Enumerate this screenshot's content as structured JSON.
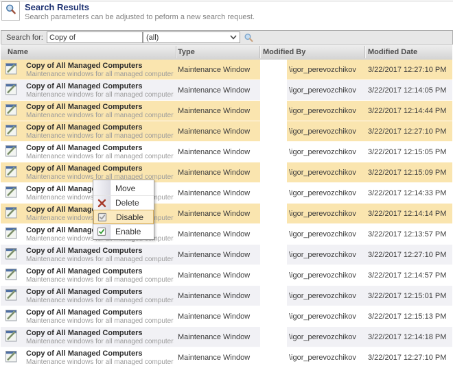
{
  "page": {
    "title": "Search Results",
    "subtitle": "Search parameters can be adjusted to peform a new search request."
  },
  "search_bar": {
    "label": "Search for:",
    "query_value": "Copy of",
    "filter_value": "(all)"
  },
  "icons": {
    "page_icon": "magnifier",
    "search_button": "magnifier",
    "row_icon": "maintenance-window",
    "dropdown": "chevron-down"
  },
  "colors": {
    "title_blue": "#1e3272",
    "selected_row": "#fae5af",
    "alt_row": "#f1f1f5",
    "menu_highlight_bg": "#fbeac0",
    "menu_highlight_border": "#d8af5e",
    "delete_x": "#a63a2a",
    "enable_check": "#2e9b2e"
  },
  "table": {
    "columns": [
      "Name",
      "Type",
      "Modified By",
      "Modified Date"
    ],
    "rows": [
      {
        "name": "Copy of All Managed Computers",
        "desc": "Maintenance windows for all managed computers.",
        "type": "Maintenance Window",
        "modified_by": "\\igor_perevozchikov",
        "modified_date": "3/22/2017 12:27:10 PM",
        "state": "selected"
      },
      {
        "name": "Copy of All Managed Computers",
        "desc": "Maintenance windows for all managed computers.",
        "type": "Maintenance Window",
        "modified_by": "\\igor_perevozchikov",
        "modified_date": "3/22/2017 12:14:05 PM",
        "state": "alt"
      },
      {
        "name": "Copy of All Managed Computers",
        "desc": "Maintenance windows for all managed computers.",
        "type": "Maintenance Window",
        "modified_by": "\\igor_perevozchikov",
        "modified_date": "3/22/2017 12:14:44 PM",
        "state": "selected"
      },
      {
        "name": "Copy of All Managed Computers",
        "desc": "Maintenance windows for all managed computers.",
        "type": "Maintenance Window",
        "modified_by": "\\igor_perevozchikov",
        "modified_date": "3/22/2017 12:27:10 PM",
        "state": "selected"
      },
      {
        "name": "Copy of All Managed Computers",
        "desc": "Maintenance windows for all managed computers.",
        "type": "Maintenance Window",
        "modified_by": "\\igor_perevozchikov",
        "modified_date": "3/22/2017 12:15:05 PM",
        "state": "plain"
      },
      {
        "name": "Copy of All Managed Computers",
        "desc": "Maintenance windows for all managed computers.",
        "type": "Maintenance Window",
        "modified_by": "\\igor_perevozchikov",
        "modified_date": "3/22/2017 12:15:09 PM",
        "state": "selected"
      },
      {
        "name": "Copy of All Managed Computers",
        "desc": "Maintenance windows for all managed computers.",
        "type": "Maintenance Window",
        "modified_by": "\\igor_perevozchikov",
        "modified_date": "3/22/2017 12:14:33 PM",
        "state": "plain"
      },
      {
        "name": "Copy of All Managed Computers",
        "desc": "Maintenance windows for all managed computers.",
        "type": "Maintenance Window",
        "modified_by": "\\igor_perevozchikov",
        "modified_date": "3/22/2017 12:14:14 PM",
        "state": "selected"
      },
      {
        "name": "Copy of All Managed Computers",
        "desc": "Maintenance windows for all managed computers.",
        "type": "Maintenance Window",
        "modified_by": "\\igor_perevozchikov",
        "modified_date": "3/22/2017 12:13:57 PM",
        "state": "plain"
      },
      {
        "name": "Copy of All Managed Computers",
        "desc": "Maintenance windows for all managed computers.",
        "type": "Maintenance Window",
        "modified_by": "\\igor_perevozchikov",
        "modified_date": "3/22/2017 12:27:10 PM",
        "state": "alt"
      },
      {
        "name": "Copy of All Managed Computers",
        "desc": "Maintenance windows for all managed computers.",
        "type": "Maintenance Window",
        "modified_by": "\\igor_perevozchikov",
        "modified_date": "3/22/2017 12:14:57 PM",
        "state": "plain"
      },
      {
        "name": "Copy of All Managed Computers",
        "desc": "Maintenance windows for all managed computers.",
        "type": "Maintenance Window",
        "modified_by": "\\igor_perevozchikov",
        "modified_date": "3/22/2017 12:15:01 PM",
        "state": "alt"
      },
      {
        "name": "Copy of All Managed Computers",
        "desc": "Maintenance windows for all managed computers.",
        "type": "Maintenance Window",
        "modified_by": "\\igor_perevozchikov",
        "modified_date": "3/22/2017 12:15:13 PM",
        "state": "plain"
      },
      {
        "name": "Copy of All Managed Computers",
        "desc": "Maintenance windows for all managed computers.",
        "type": "Maintenance Window",
        "modified_by": "\\igor_perevozchikov",
        "modified_date": "3/22/2017 12:14:18 PM",
        "state": "alt"
      },
      {
        "name": "Copy of All Managed Computers",
        "desc": "Maintenance windows for all managed computers.",
        "type": "Maintenance Window",
        "modified_by": "\\igor_perevozchikov",
        "modified_date": "3/22/2017 12:27:10 PM",
        "state": "plain"
      }
    ]
  },
  "context_menu": {
    "items": [
      {
        "label": "Move",
        "icon": "none",
        "state": "normal"
      },
      {
        "label": "Delete",
        "icon": "delete-icon",
        "state": "normal"
      },
      {
        "label": "Disable",
        "icon": "disable-icon",
        "state": "hover"
      },
      {
        "label": "Enable",
        "icon": "enable-icon",
        "state": "normal"
      }
    ]
  }
}
